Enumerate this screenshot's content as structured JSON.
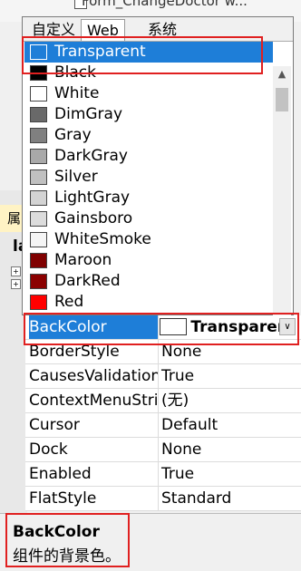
{
  "background_form_title": "Form_ChangeDoctor w...",
  "side_label": "属",
  "side_bold": "la",
  "dropdown": {
    "tabs": [
      {
        "label": "自定义",
        "active": false
      },
      {
        "label": "Web",
        "active": true
      },
      {
        "label": "系统",
        "active": false
      }
    ],
    "colors": [
      {
        "name": "Transparent",
        "swatch": "#1e7ed8",
        "selected": true
      },
      {
        "name": "Black",
        "swatch": "#000000"
      },
      {
        "name": "White",
        "swatch": "#ffffff"
      },
      {
        "name": "DimGray",
        "swatch": "#696969"
      },
      {
        "name": "Gray",
        "swatch": "#808080"
      },
      {
        "name": "DarkGray",
        "swatch": "#a9a9a9"
      },
      {
        "name": "Silver",
        "swatch": "#c0c0c0"
      },
      {
        "name": "LightGray",
        "swatch": "#d3d3d3"
      },
      {
        "name": "Gainsboro",
        "swatch": "#dcdcdc"
      },
      {
        "name": "WhiteSmoke",
        "swatch": "#f5f5f5"
      },
      {
        "name": "Maroon",
        "swatch": "#800000"
      },
      {
        "name": "DarkRed",
        "swatch": "#8b0000"
      },
      {
        "name": "Red",
        "swatch": "#ff0000"
      }
    ]
  },
  "properties": [
    {
      "name": "BackColor",
      "value": "Transparent",
      "selected": true
    },
    {
      "name": "BorderStyle",
      "value": "None"
    },
    {
      "name": "CausesValidation",
      "value": "True"
    },
    {
      "name": "ContextMenuStrip",
      "value": "(无)"
    },
    {
      "name": "Cursor",
      "value": "Default"
    },
    {
      "name": "Dock",
      "value": "None"
    },
    {
      "name": "Enabled",
      "value": "True"
    },
    {
      "name": "FlatStyle",
      "value": "Standard"
    }
  ],
  "description": {
    "title": "BackColor",
    "text": "组件的背景色。"
  },
  "colors": {
    "selection": "#1e7ed8",
    "highlight_box": "#e02020"
  }
}
